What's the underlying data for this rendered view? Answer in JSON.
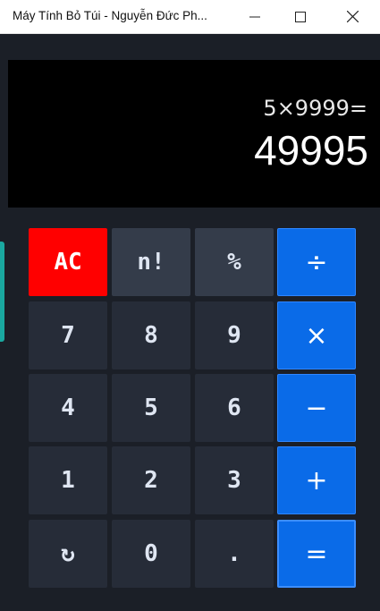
{
  "window": {
    "title": "Máy Tính Bỏ Túi - Nguyễn Đức Ph...",
    "controls": [
      "minimize-icon",
      "maximize-icon",
      "close-icon"
    ]
  },
  "display": {
    "expression": "5×9999=",
    "result": "49995"
  },
  "keys": {
    "ac": "AC",
    "factorial": "n!",
    "percent": "%",
    "divide": "÷",
    "seven": "7",
    "eight": "8",
    "nine": "9",
    "multiply": "×",
    "four": "4",
    "five": "5",
    "six": "6",
    "minus": "−",
    "one": "1",
    "two": "2",
    "three": "3",
    "plus": "+",
    "undo": "↻",
    "zero": "0",
    "dot": ".",
    "equals": "="
  },
  "colors": {
    "background": "#1b1f27",
    "key": "#262c38",
    "function_key": "#343c4a",
    "clear_key": "#ff0000",
    "operator_key": "#0a6be8"
  }
}
